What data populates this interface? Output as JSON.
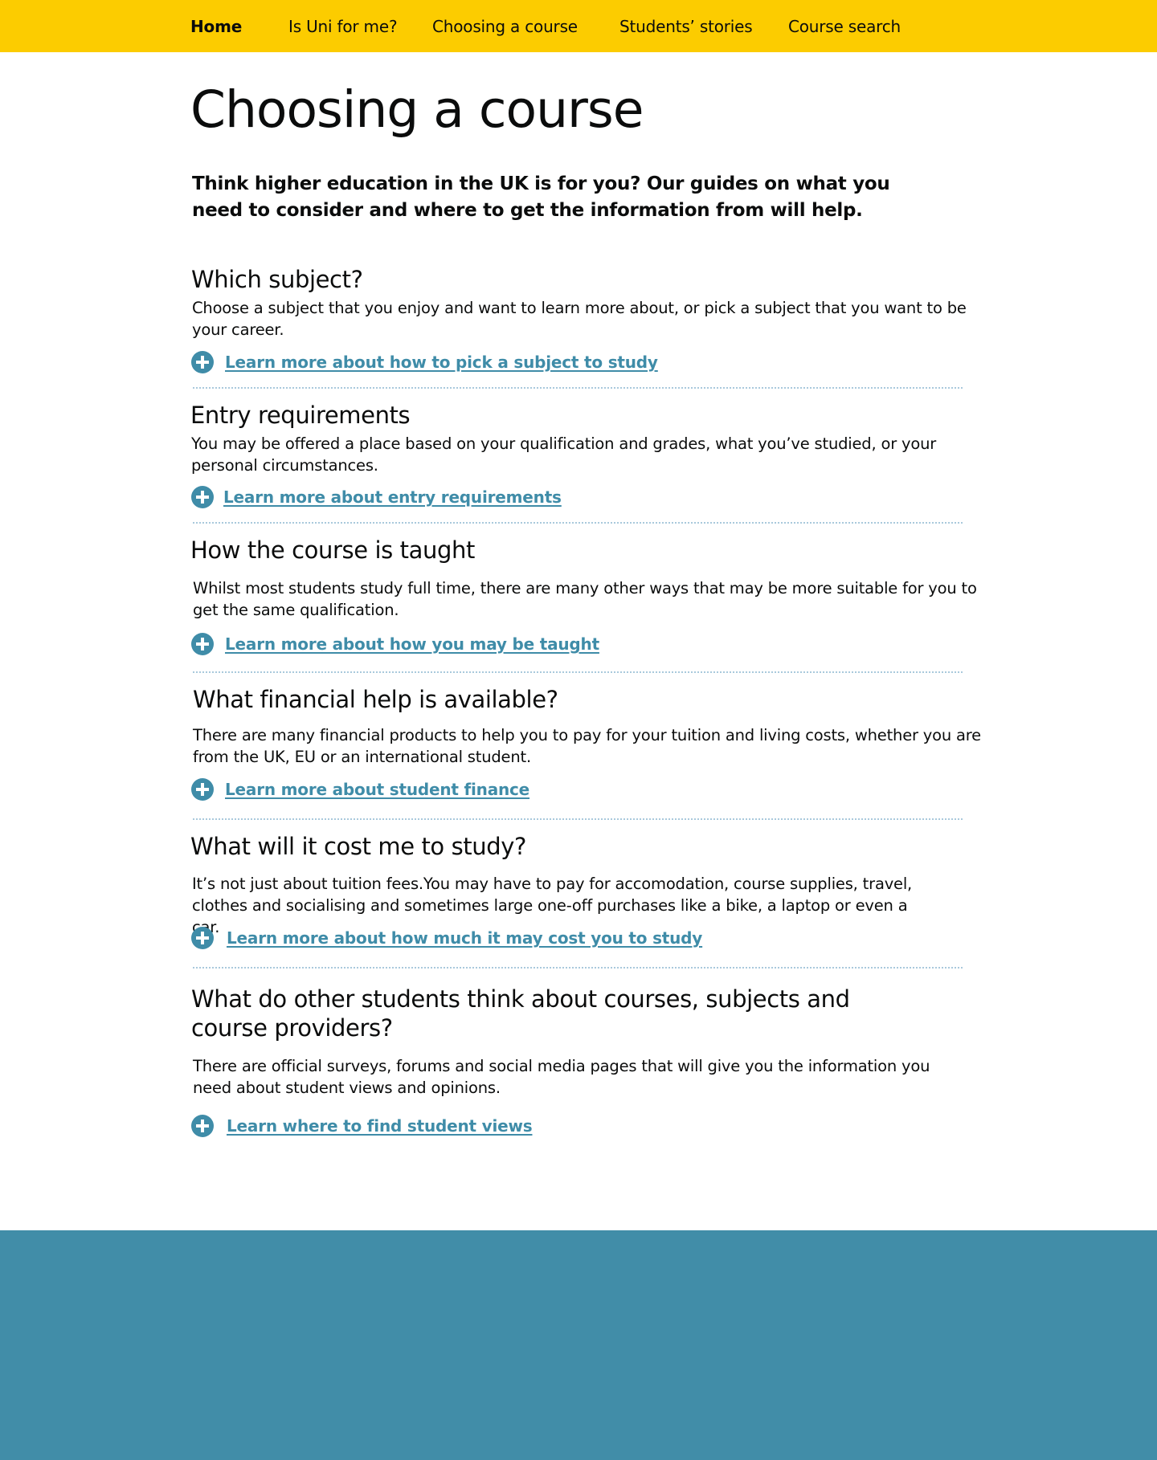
{
  "nav": {
    "items": [
      {
        "label": "Home"
      },
      {
        "label": "Is Uni for me?"
      },
      {
        "label": "Choosing a course"
      },
      {
        "label": "Students’ stories"
      },
      {
        "label": "Course search"
      }
    ]
  },
  "page": {
    "title": "Choosing a course",
    "intro": "Think higher education in the UK is for you? Our guides on what you need to consider and where to get the information from will help."
  },
  "sections": [
    {
      "heading": "Which subject?",
      "text": "Choose a subject that you enjoy and want to learn more about, or pick a subject that you want to be your career.",
      "link": "Learn more about how to pick a subject to study"
    },
    {
      "heading": "Entry requirements",
      "text": "You may be offered a place based on your qualification and grades, what you’ve studied, or your personal circumstances.",
      "link": "Learn more about entry requirements"
    },
    {
      "heading": "How the course is taught",
      "text": "Whilst most students study full time, there are many other ways that may be more suitable for you to get the same qualification.",
      "link": "Learn more about how you may be taught"
    },
    {
      "heading": "What financial help is available?",
      "text": "There are many financial products to help you to pay for your tuition and living costs, whether you are from the UK, EU or an international student.",
      "link": "Learn more about student finance"
    },
    {
      "heading": "What will it cost me to study?",
      "text": "It’s not just about tuition fees.You may have to pay for accomodation, course supplies, travel, clothes and socialising and sometimes large one-off purchases like a bike, a laptop or even a car.",
      "link": "Learn more about how much it may cost you to study"
    },
    {
      "heading": "What do other students think about courses, subjects and course providers?",
      "text": "There are official surveys, forums and social media pages that will give you the information you need about student views and opinions.",
      "link": "Learn where to find student views"
    }
  ],
  "colors": {
    "nav_background": "#fccc00",
    "link": "#3f8ca8",
    "footer_background": "#418da8"
  },
  "icons": {
    "expand": "plus-circle-icon"
  }
}
